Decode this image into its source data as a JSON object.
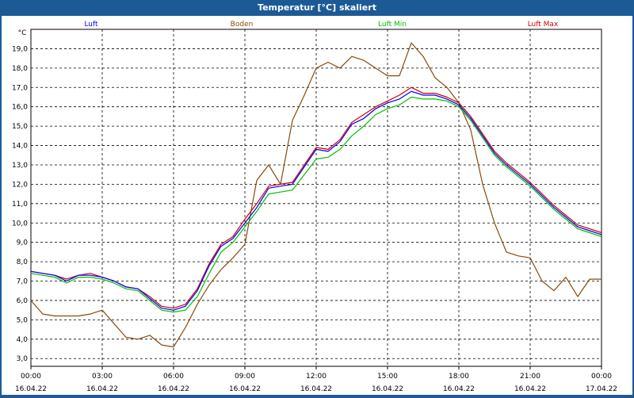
{
  "window": {
    "title": "Temperatur [°C] skaliert"
  },
  "chart_data": {
    "type": "line",
    "title": "Temperatur [°C] skaliert",
    "ylabel": "°C",
    "ylim": [
      2.6,
      20.0
    ],
    "yticks": [
      "3,0",
      "4,0",
      "5,0",
      "6,0",
      "7,0",
      "8,0",
      "9,0",
      "10,0",
      "11,0",
      "12,0",
      "13,0",
      "14,0",
      "15,0",
      "16,0",
      "17,0",
      "18,0",
      "19,0"
    ],
    "ytick_values": [
      3,
      4,
      5,
      6,
      7,
      8,
      9,
      10,
      11,
      12,
      13,
      14,
      15,
      16,
      17,
      18,
      19
    ],
    "xlim": [
      0,
      24
    ],
    "xtick_values": [
      0,
      3,
      6,
      9,
      12,
      15,
      18,
      21,
      24
    ],
    "xtick_times": [
      "00:00",
      "03:00",
      "06:00",
      "09:00",
      "12:00",
      "15:00",
      "18:00",
      "21:00",
      "00:00"
    ],
    "xtick_dates": [
      "16.04.22",
      "16.04.22",
      "16.04.22",
      "16.04.22",
      "16.04.22",
      "16.04.22",
      "16.04.22",
      "16.04.22",
      "17.04.22"
    ],
    "grid": true,
    "legend_position": "top",
    "series": [
      {
        "name": "Luft",
        "color": "#0000ff",
        "x": [
          0,
          0.5,
          1,
          1.5,
          2,
          2.5,
          3,
          3.5,
          4,
          4.5,
          5,
          5.5,
          6,
          6.5,
          7,
          7.5,
          8,
          8.5,
          9,
          9.5,
          10,
          10.5,
          11,
          11.5,
          12,
          12.5,
          13,
          13.5,
          14,
          14.5,
          15,
          15.5,
          16,
          16.5,
          17,
          17.5,
          18,
          18.5,
          19,
          19.5,
          20,
          20.5,
          21,
          21.5,
          22,
          22.5,
          23,
          23.5,
          24
        ],
        "y": [
          7.5,
          7.4,
          7.3,
          7.0,
          7.3,
          7.3,
          7.2,
          7.0,
          6.7,
          6.6,
          6.1,
          5.6,
          5.5,
          5.7,
          6.5,
          7.8,
          8.8,
          9.2,
          10.0,
          10.8,
          11.8,
          11.9,
          12.0,
          12.9,
          13.8,
          13.7,
          14.2,
          15.1,
          15.4,
          15.9,
          16.2,
          16.4,
          16.8,
          16.6,
          16.6,
          16.4,
          16.1,
          15.4,
          14.5,
          13.6,
          13.0,
          12.5,
          12.0,
          11.4,
          10.8,
          10.3,
          9.8,
          9.6,
          9.4
        ]
      },
      {
        "name": "Boden",
        "color": "#8a4a0a",
        "x": [
          0,
          0.5,
          1,
          1.5,
          2,
          2.5,
          3,
          3.5,
          4,
          4.5,
          5,
          5.5,
          6,
          6.5,
          7,
          7.5,
          8,
          8.5,
          9,
          9.5,
          10,
          10.5,
          11,
          11.5,
          12,
          12.5,
          13,
          13.5,
          14,
          14.5,
          15,
          15.5,
          16,
          16.5,
          17,
          17.5,
          18,
          18.5,
          19,
          19.5,
          20,
          20.5,
          21,
          21.5,
          22,
          22.5,
          23,
          23.5,
          24
        ],
        "y": [
          6.0,
          5.3,
          5.2,
          5.2,
          5.2,
          5.3,
          5.5,
          4.8,
          4.1,
          4.0,
          4.2,
          3.7,
          3.6,
          4.6,
          5.8,
          6.8,
          7.6,
          8.2,
          8.9,
          12.2,
          13.0,
          12.0,
          15.3,
          16.6,
          18.0,
          18.3,
          18.0,
          18.6,
          18.4,
          18.0,
          17.6,
          17.6,
          19.3,
          18.6,
          17.5,
          17.0,
          16.2,
          14.8,
          12.0,
          10.0,
          8.5,
          8.3,
          8.2,
          7.0,
          6.5,
          7.2,
          6.2,
          7.1,
          7.1
        ]
      },
      {
        "name": "Luft Min",
        "color": "#00c000",
        "x": [
          0,
          0.5,
          1,
          1.5,
          2,
          2.5,
          3,
          3.5,
          4,
          4.5,
          5,
          5.5,
          6,
          6.5,
          7,
          7.5,
          8,
          8.5,
          9,
          9.5,
          10,
          10.5,
          11,
          11.5,
          12,
          12.5,
          13,
          13.5,
          14,
          14.5,
          15,
          15.5,
          16,
          16.5,
          17,
          17.5,
          18,
          18.5,
          19,
          19.5,
          20,
          20.5,
          21,
          21.5,
          22,
          22.5,
          23,
          23.5,
          24
        ],
        "y": [
          7.4,
          7.3,
          7.2,
          6.9,
          7.2,
          7.2,
          7.1,
          6.9,
          6.6,
          6.5,
          6.0,
          5.5,
          5.4,
          5.5,
          6.2,
          7.4,
          8.5,
          9.0,
          9.8,
          10.6,
          11.5,
          11.6,
          11.7,
          12.5,
          13.3,
          13.4,
          13.8,
          14.5,
          15.0,
          15.6,
          15.9,
          16.1,
          16.5,
          16.4,
          16.4,
          16.3,
          16.0,
          15.3,
          14.4,
          13.5,
          12.9,
          12.4,
          11.9,
          11.3,
          10.7,
          10.2,
          9.7,
          9.5,
          9.3
        ]
      },
      {
        "name": "Luft Max",
        "color": "#d00000",
        "x": [
          0,
          0.5,
          1,
          1.5,
          2,
          2.5,
          3,
          3.5,
          4,
          4.5,
          5,
          5.5,
          6,
          6.5,
          7,
          7.5,
          8,
          8.5,
          9,
          9.5,
          10,
          10.5,
          11,
          11.5,
          12,
          12.5,
          13,
          13.5,
          14,
          14.5,
          15,
          15.5,
          16,
          16.5,
          17,
          17.5,
          18,
          18.5,
          19,
          19.5,
          20,
          20.5,
          21,
          21.5,
          22,
          22.5,
          23,
          23.5,
          24
        ],
        "y": [
          7.5,
          7.4,
          7.3,
          7.1,
          7.3,
          7.4,
          7.2,
          7.0,
          6.7,
          6.6,
          6.2,
          5.7,
          5.6,
          5.8,
          6.6,
          7.9,
          8.9,
          9.3,
          10.2,
          11.0,
          11.9,
          12.0,
          12.1,
          13.0,
          13.9,
          13.8,
          14.3,
          15.2,
          15.6,
          16.0,
          16.3,
          16.6,
          17.0,
          16.7,
          16.7,
          16.5,
          16.2,
          15.5,
          14.6,
          13.7,
          13.1,
          12.6,
          12.1,
          11.5,
          10.9,
          10.4,
          9.9,
          9.7,
          9.5
        ]
      }
    ]
  }
}
